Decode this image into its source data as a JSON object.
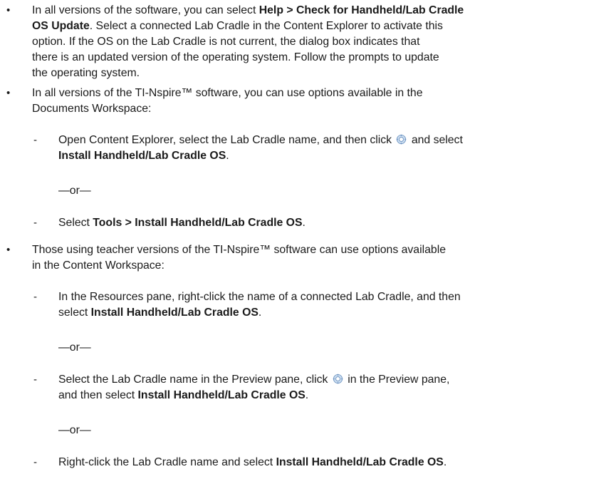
{
  "bullet_1": {
    "l1": "In all versions of the software, you can select ",
    "l1_bold": "Help > Check for Handheld/Lab Cradle",
    "l2_bold": "OS Update",
    "l2": ". Select a connected Lab Cradle in the Content Explorer to activate this",
    "l3": "option. If the OS on the Lab Cradle is not current, the dialog box indicates that",
    "l4": "there is an updated version of the operating system. Follow the prompts to update",
    "l5": "the operating system."
  },
  "bullet_2": {
    "l1": "In all versions of the TI-Nspire™ software, you can use options available in the",
    "l2": "Documents Workspace:",
    "sub_1": {
      "l1_a": "Open Content Explorer, select the Lab Cradle name, and then click ",
      "l1_b": " and select",
      "l2_bold": "Install Handheld/Lab Cradle OS",
      "l2_end": "."
    },
    "or": "—or—",
    "sub_2": {
      "a": "Select ",
      "bold": "Tools > Install Handheld/Lab Cradle OS",
      "end": "."
    }
  },
  "bullet_3": {
    "l1": "Those using teacher versions of the TI-Nspire™ software can use options available",
    "l2": "in the Content Workspace:",
    "sub_1": {
      "l1": "In the Resources pane, right-click the name of a connected Lab Cradle, and then",
      "l2_a": "select ",
      "l2_bold": "Install Handheld/Lab Cradle OS",
      "l2_end": "."
    },
    "or_1": "—or—",
    "sub_2": {
      "l1_a": "Select the Lab Cradle name in the Preview pane, click ",
      "l1_b": " in the Preview pane,",
      "l2_a": "and then select ",
      "l2_bold": "Install Handheld/Lab Cradle OS",
      "l2_end": "."
    },
    "or_2": "—or—",
    "sub_3": {
      "a": "Right-click the Lab Cradle name and select ",
      "bold": "Install Handheld/Lab Cradle OS",
      "end": "."
    }
  },
  "glyphs": {
    "bullet": "•",
    "dash": "-"
  },
  "icons": {
    "gear": "gear-icon"
  }
}
